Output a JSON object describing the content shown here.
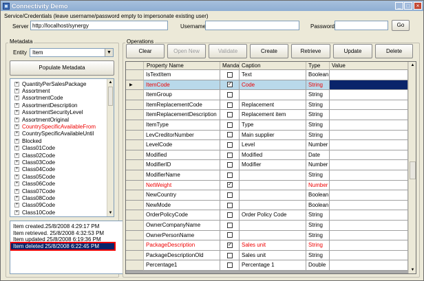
{
  "window": {
    "title": "Connectivity Demo"
  },
  "service": {
    "group_label": "Service/Credentials (leave username/password empty to impersonate existing user)",
    "server_label": "Server",
    "server_value": "http://localhost/synergy",
    "username_label": "Username",
    "username_value": "",
    "password_label": "Password",
    "password_value": "",
    "go_label": "Go"
  },
  "metadata": {
    "group_label": "Metadata",
    "entity_label": "Entity",
    "entity_value": "Item",
    "populate_label": "Populate Metadata",
    "tree_items": [
      {
        "label": "QuantityPerSalesPackage",
        "red": false
      },
      {
        "label": "Assortment",
        "red": false
      },
      {
        "label": "AssortmentCode",
        "red": false
      },
      {
        "label": "AssortmentDescription",
        "red": false
      },
      {
        "label": "AssortmentSecurityLevel",
        "red": false
      },
      {
        "label": "AssortmentOriginal",
        "red": false
      },
      {
        "label": "CountrySpecificAvailableFrom",
        "red": true
      },
      {
        "label": "CountrySpecificAvailableUntil",
        "red": false
      },
      {
        "label": "Blocked",
        "red": false
      },
      {
        "label": "Class01Code",
        "red": false
      },
      {
        "label": "Class02Code",
        "red": false
      },
      {
        "label": "Class03Code",
        "red": false
      },
      {
        "label": "Class04Code",
        "red": false
      },
      {
        "label": "Class05Code",
        "red": false
      },
      {
        "label": "Class06Code",
        "red": false
      },
      {
        "label": "Class07Code",
        "red": false
      },
      {
        "label": "Class08Code",
        "red": false
      },
      {
        "label": "Class09Code",
        "red": false
      },
      {
        "label": "Class10Code",
        "red": false
      }
    ],
    "log": [
      "Item created.25/8/2008 4:29:17 PM",
      "Item retrieved. 25/8/2008 4:32:53 PM",
      "Item updated 25/8/2008 6:19:36 PM",
      "Item deleted 25/8/2008 6:22:45 PM"
    ]
  },
  "operations": {
    "group_label": "Operations",
    "buttons": [
      "Clear",
      "Open New",
      "Validate",
      "Create",
      "Retrieve",
      "Update",
      "Delete"
    ],
    "columns": [
      "Property Name",
      "Mandatory",
      "Caption",
      "Type",
      "Value"
    ],
    "rows": [
      {
        "name": "IsTextItem",
        "mandatory": false,
        "caption": "Text",
        "type": "Boolean",
        "red": false,
        "selected": false
      },
      {
        "name": "ItemCode",
        "mandatory": true,
        "caption": "Code",
        "type": "String",
        "red": true,
        "selected": true
      },
      {
        "name": "ItemGroup",
        "mandatory": false,
        "caption": "",
        "type": "String",
        "red": false,
        "selected": false
      },
      {
        "name": "ItemReplacementCode",
        "mandatory": false,
        "caption": "Replacement",
        "type": "String",
        "red": false,
        "selected": false
      },
      {
        "name": "ItemReplacementDescription",
        "mandatory": false,
        "caption": "Replacement item",
        "type": "String",
        "red": false,
        "selected": false
      },
      {
        "name": "ItemType",
        "mandatory": false,
        "caption": "Type",
        "type": "String",
        "red": false,
        "selected": false
      },
      {
        "name": "LevCreditorNumber",
        "mandatory": false,
        "caption": "Main supplier",
        "type": "String",
        "red": false,
        "selected": false
      },
      {
        "name": "LevelCode",
        "mandatory": false,
        "caption": "Level",
        "type": "Number",
        "red": false,
        "selected": false
      },
      {
        "name": "Modified",
        "mandatory": false,
        "caption": "Modified",
        "type": "Date",
        "red": false,
        "selected": false
      },
      {
        "name": "ModifierID",
        "mandatory": false,
        "caption": "Modifier",
        "type": "Number",
        "red": false,
        "selected": false
      },
      {
        "name": "ModifierName",
        "mandatory": false,
        "caption": "",
        "type": "String",
        "red": false,
        "selected": false
      },
      {
        "name": "NetWeight",
        "mandatory": true,
        "caption": "",
        "type": "Number",
        "red": true,
        "selected": false
      },
      {
        "name": "NewCountry",
        "mandatory": false,
        "caption": "",
        "type": "Boolean",
        "red": false,
        "selected": false
      },
      {
        "name": "NewMode",
        "mandatory": false,
        "caption": "",
        "type": "Boolean",
        "red": false,
        "selected": false
      },
      {
        "name": "OrderPolicyCode",
        "mandatory": false,
        "caption": "Order Policy Code",
        "type": "String",
        "red": false,
        "selected": false
      },
      {
        "name": "OwnerCompanyName",
        "mandatory": false,
        "caption": "",
        "type": "String",
        "red": false,
        "selected": false
      },
      {
        "name": "OwnerPersonName",
        "mandatory": false,
        "caption": "",
        "type": "String",
        "red": false,
        "selected": false
      },
      {
        "name": "PackageDescription",
        "mandatory": true,
        "caption": "Sales unit",
        "type": "String",
        "red": true,
        "selected": false
      },
      {
        "name": "PackageDescriptionOld",
        "mandatory": false,
        "caption": "Sales unit",
        "type": "String",
        "red": false,
        "selected": false
      },
      {
        "name": "Percentage1",
        "mandatory": false,
        "caption": "Percentage 1",
        "type": "Double",
        "red": false,
        "selected": false
      }
    ]
  },
  "colors": {
    "required_red": "#ee0000",
    "selected_row": "#b9d9ea",
    "value_selected": "#0a246a"
  }
}
